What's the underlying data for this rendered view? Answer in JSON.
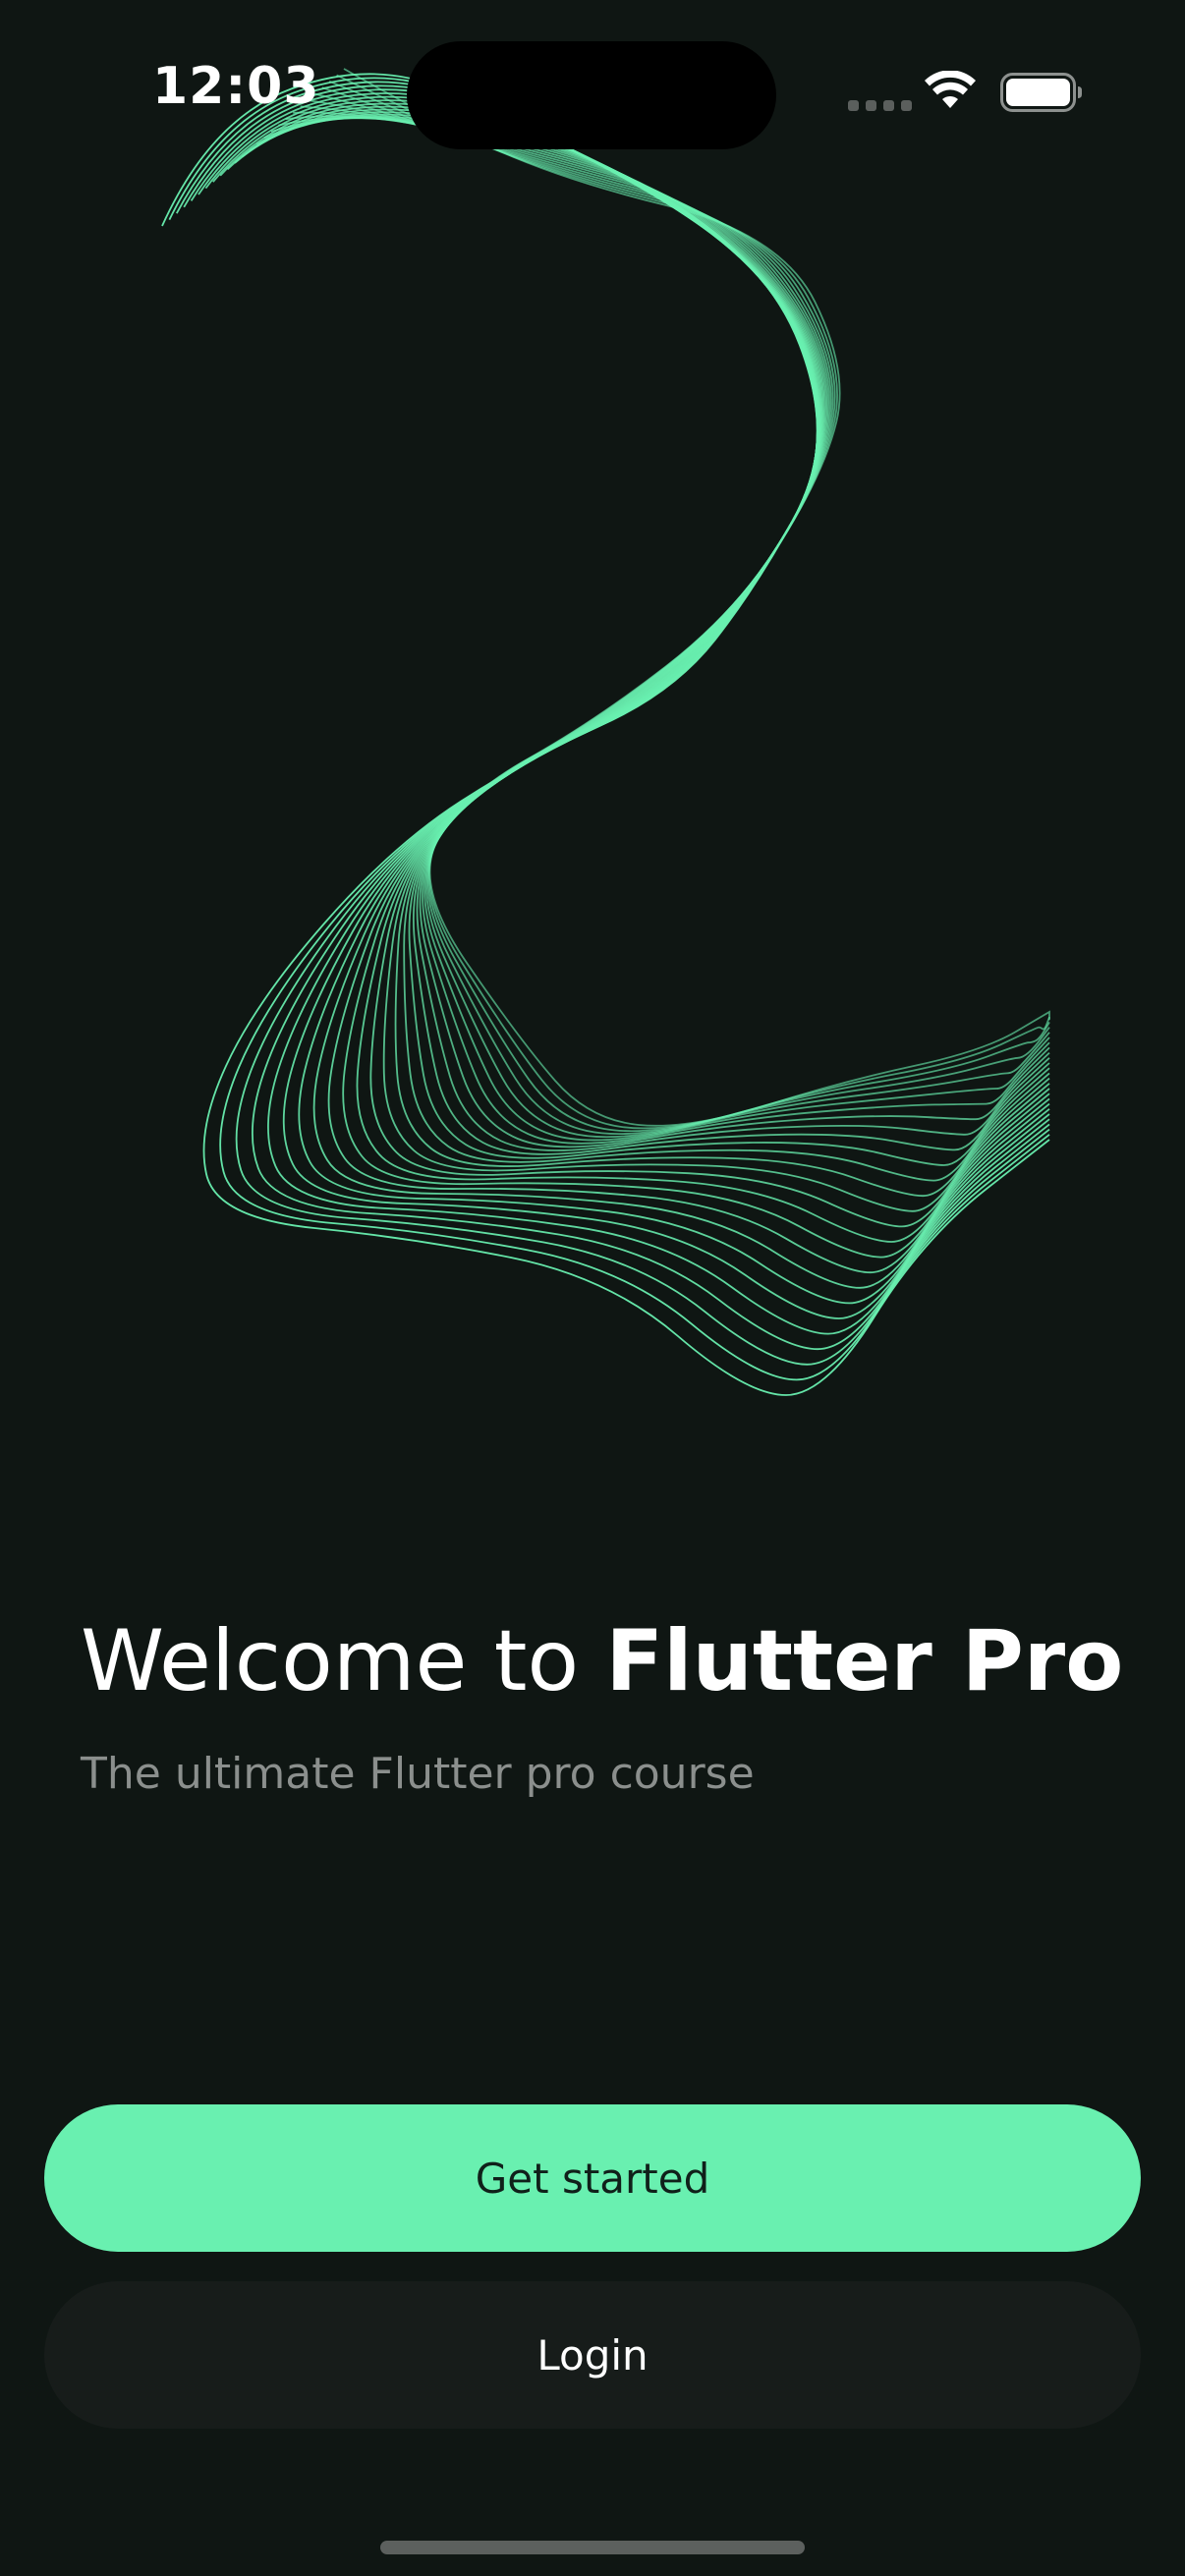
{
  "status_bar": {
    "time": "12:03"
  },
  "welcome": {
    "title_prefix": "Welcome to ",
    "title_brand": "Flutter Pro",
    "subtitle": "The ultimate Flutter pro course"
  },
  "actions": {
    "primary_label": "Get started",
    "secondary_label": "Login"
  },
  "colors": {
    "background": "#0f1613",
    "accent": "#69f0b0",
    "secondary_button": "#171c1a",
    "subtitle_text": "#8b8f8d"
  },
  "icons": {
    "wifi": "wifi-icon",
    "battery": "battery-icon",
    "signal": "cellular-signal-icon"
  }
}
